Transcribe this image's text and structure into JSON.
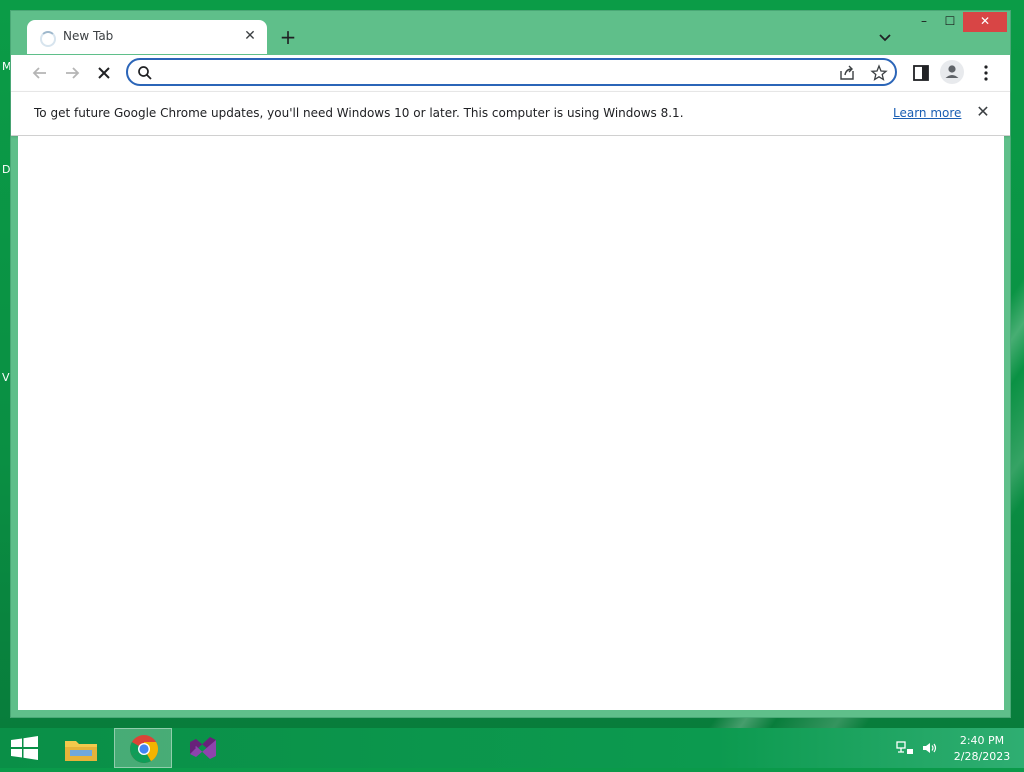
{
  "desktop": {
    "edge_letters": [
      "M",
      "D",
      "V"
    ]
  },
  "browser": {
    "tab": {
      "title": "New Tab",
      "close_symbol": "✕"
    },
    "new_tab_symbol": "+",
    "window_controls": {
      "minimize": "–",
      "maximize": "☐",
      "close": "✕"
    },
    "omnibox": {
      "value": "",
      "placeholder": ""
    },
    "infobar": {
      "message": "To get future Google Chrome updates, you'll need Windows 10 or later. This computer is using Windows 8.1.",
      "link": "Learn more",
      "close_symbol": "✕"
    }
  },
  "taskbar": {
    "apps": [
      "start-button",
      "file-explorer-icon",
      "chrome-icon",
      "visual-studio-icon"
    ],
    "clock": {
      "time": "2:40 PM",
      "date": "2/28/2023"
    }
  },
  "colors": {
    "window_frame": "#5fbf8a",
    "omnibox_border": "#2b65b8",
    "link": "#1a5fb4",
    "close_button": "#d84545"
  }
}
